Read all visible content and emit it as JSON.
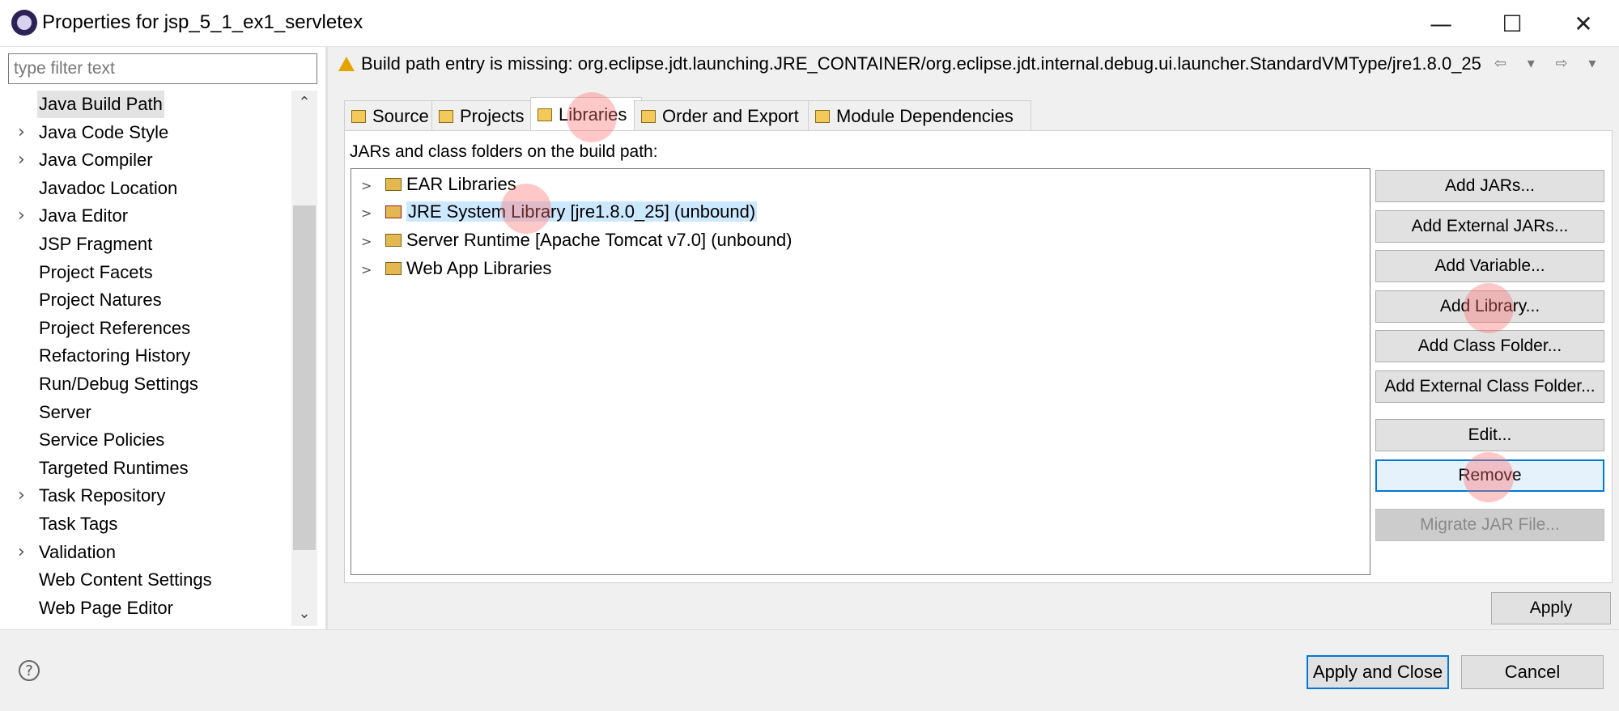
{
  "window": {
    "title": "Properties for jsp_5_1_ex1_servletex",
    "minimize_glyph": "—",
    "maximize_glyph": "☐",
    "close_glyph": "✕"
  },
  "filter": {
    "placeholder": "type filter text"
  },
  "nav": {
    "items": [
      {
        "label": "Java Build Path",
        "expandable": false,
        "selected": true
      },
      {
        "label": "Java Code Style",
        "expandable": true
      },
      {
        "label": "Java Compiler",
        "expandable": true
      },
      {
        "label": "Javadoc Location",
        "expandable": false
      },
      {
        "label": "Java Editor",
        "expandable": true
      },
      {
        "label": "JSP Fragment",
        "expandable": false
      },
      {
        "label": "Project Facets",
        "expandable": false
      },
      {
        "label": "Project Natures",
        "expandable": false
      },
      {
        "label": "Project References",
        "expandable": false
      },
      {
        "label": "Refactoring History",
        "expandable": false
      },
      {
        "label": "Run/Debug Settings",
        "expandable": false
      },
      {
        "label": "Server",
        "expandable": false
      },
      {
        "label": "Service Policies",
        "expandable": false
      },
      {
        "label": "Targeted Runtimes",
        "expandable": false
      },
      {
        "label": "Task Repository",
        "expandable": true
      },
      {
        "label": "Task Tags",
        "expandable": false
      },
      {
        "label": "Validation",
        "expandable": true
      },
      {
        "label": "Web Content Settings",
        "expandable": false
      },
      {
        "label": "Web Page Editor",
        "expandable": false
      }
    ]
  },
  "banner": {
    "message": "Build path entry is missing: org.eclipse.jdt.launching.JRE_CONTAINER/org.eclipse.jdt.internal.debug.ui.launcher.StandardVMType/jre1.8.0_25",
    "nav_arrows": "⇦ ▾ ⇨ ▾ ⋮"
  },
  "tabs": [
    {
      "label": "Source"
    },
    {
      "label": "Projects"
    },
    {
      "label": "Libraries",
      "active": true
    },
    {
      "label": "Order and Export"
    },
    {
      "label": "Module Dependencies"
    }
  ],
  "libraries": {
    "heading": "JARs and class folders on the build path:",
    "entries": [
      {
        "label": "EAR Libraries"
      },
      {
        "label": "JRE System Library [jre1.8.0_25] (unbound)",
        "selected": true
      },
      {
        "label": "Server Runtime [Apache Tomcat v7.0] (unbound)"
      },
      {
        "label": "Web App Libraries"
      }
    ],
    "buttons": {
      "add_jars": "Add JARs...",
      "add_external_jars": "Add External JARs...",
      "add_variable": "Add Variable...",
      "add_library": "Add Library...",
      "add_class_folder": "Add Class Folder...",
      "add_external_class_folder": "Add External Class Folder...",
      "edit": "Edit...",
      "remove": "Remove",
      "migrate_jar": "Migrate JAR File..."
    }
  },
  "apply_label": "Apply",
  "footer": {
    "help_glyph": "?",
    "apply_close": "Apply and Close",
    "cancel": "Cancel"
  },
  "colors": {
    "selection": "#cce8ff",
    "focus_border": "#0078d7",
    "click_highlight": "#ff6e6e"
  }
}
